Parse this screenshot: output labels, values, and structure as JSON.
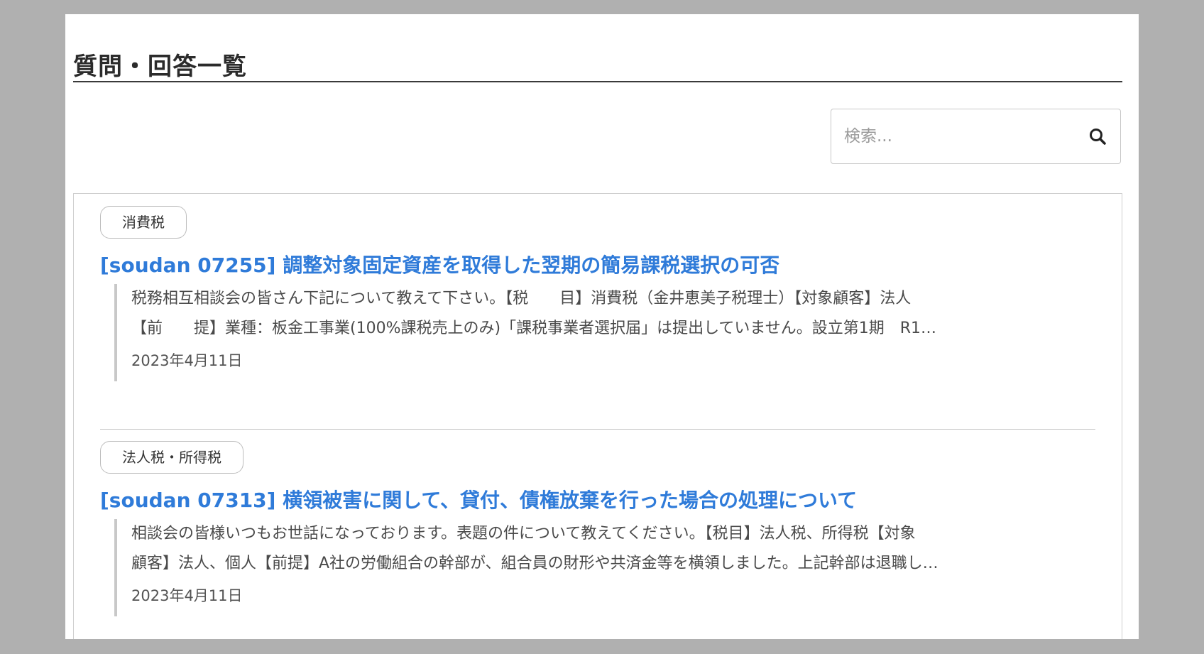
{
  "page": {
    "title": "質問・回答一覧"
  },
  "search": {
    "placeholder": "検索...",
    "icon": "search-icon"
  },
  "items": [
    {
      "category": "消費税",
      "title": "[soudan 07255] 調整対象固定資産を取得した翌期の簡易課税選択の可否",
      "excerpt_lines": [
        "税務相互相談会の皆さん下記について教えて下さい。【税　　目】消費税（金井恵美子税理士）【対象顧客】法人",
        "【前　　提】業種：板金工事業(100%課税売上のみ)「課税事業者選択届」は提出していません。設立第1期　R1…"
      ],
      "date": "2023年4月11日"
    },
    {
      "category": "法人税・所得税",
      "title": "[soudan 07313] 横領被害に関して、貸付、債権放棄を行った場合の処理について",
      "excerpt_lines": [
        "相談会の皆様いつもお世話になっております。表題の件について教えてください。【税目】法人税、所得税【対象",
        "顧客】法人、個人【前提】A社の労働組合の幹部が、組合員の財形や共済金等を横領しました。上記幹部は退職し…"
      ],
      "date": "2023年4月11日"
    }
  ],
  "colors": {
    "background": "#b0b0b0",
    "panel": "#ffffff",
    "link": "#2f7bd9",
    "text": "#4a4a4a"
  }
}
